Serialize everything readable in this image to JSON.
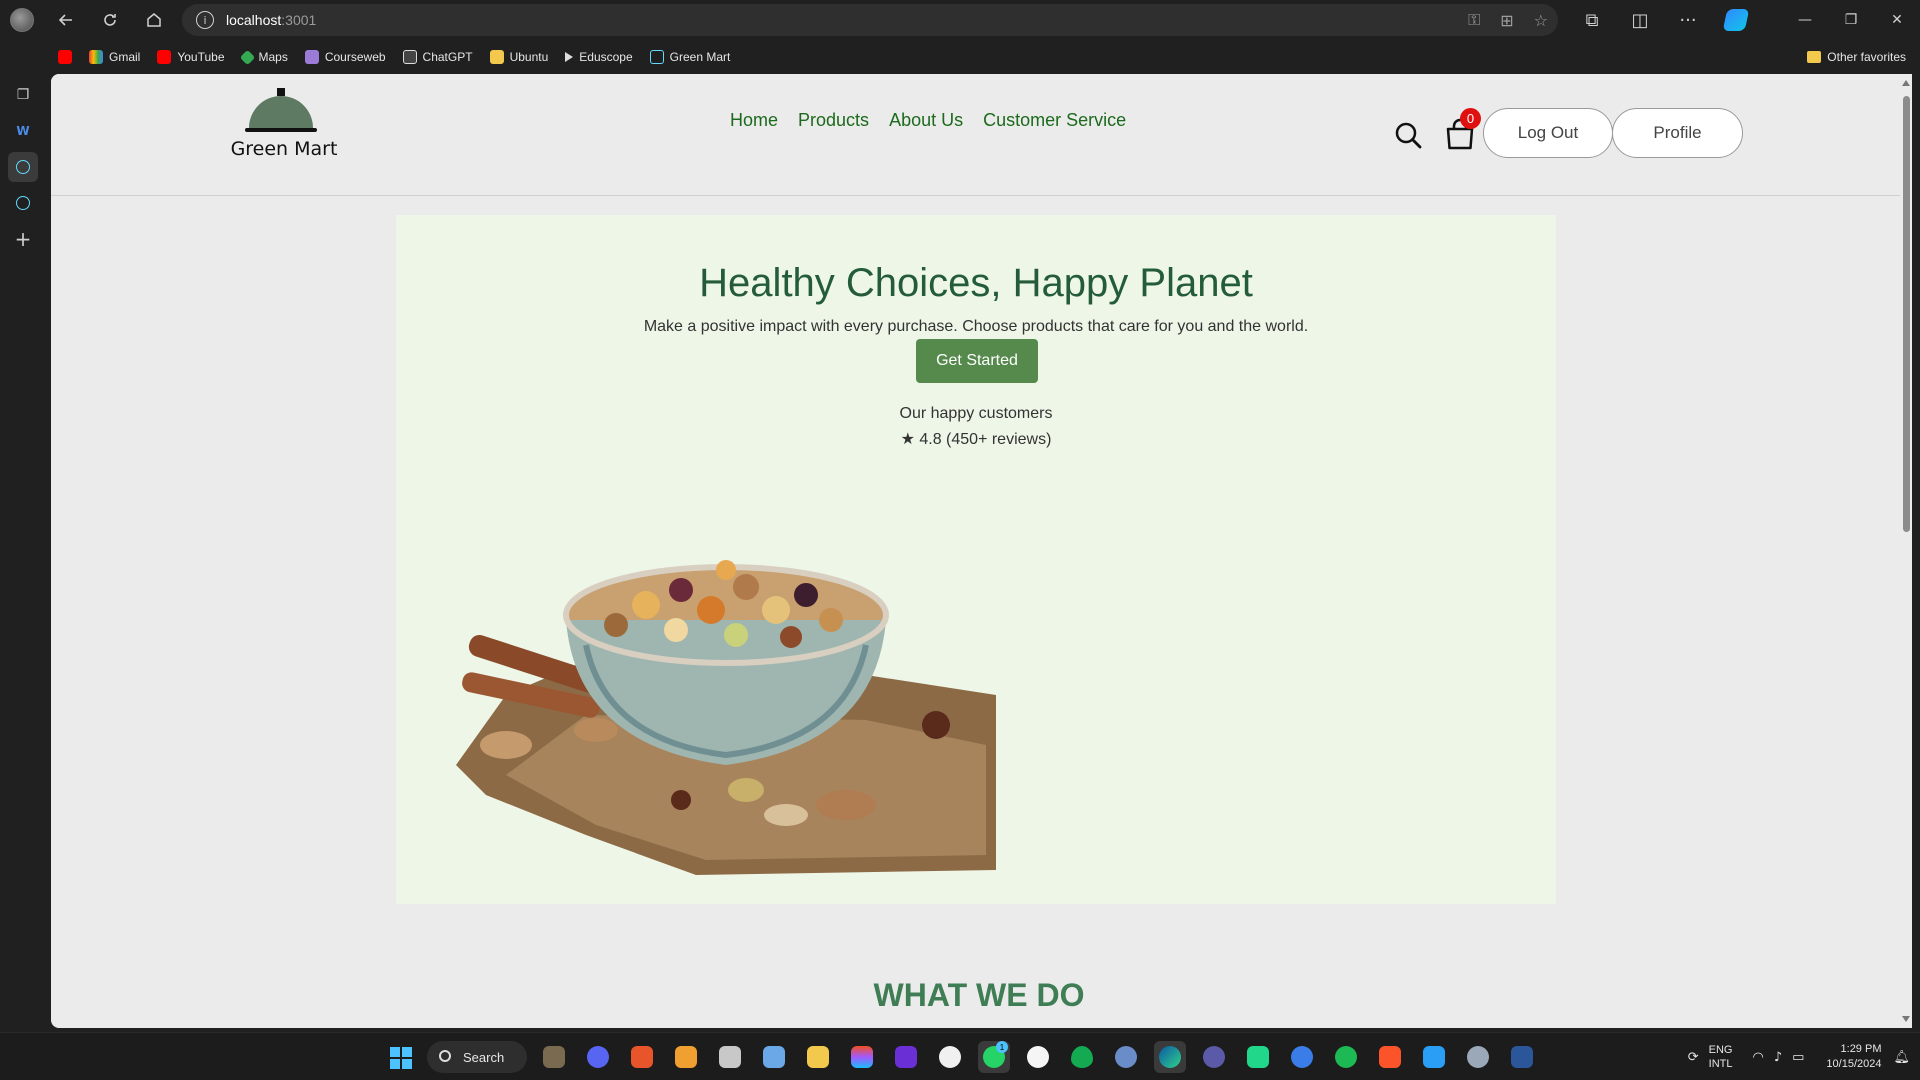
{
  "browser": {
    "url_host": "localhost",
    "url_port": ":3001",
    "bookmarks": [
      {
        "label": "",
        "icon": "youtube-icon"
      },
      {
        "label": "Gmail",
        "icon": "gmail-icon"
      },
      {
        "label": "YouTube",
        "icon": "youtube-icon"
      },
      {
        "label": "Maps",
        "icon": "maps-icon"
      },
      {
        "label": "Courseweb",
        "icon": "courseweb-icon"
      },
      {
        "label": "ChatGPT",
        "icon": "chatgpt-icon"
      },
      {
        "label": "Ubuntu",
        "icon": "folder-icon"
      },
      {
        "label": "Eduscope",
        "icon": "play-icon"
      },
      {
        "label": "Green Mart",
        "icon": "react-icon"
      }
    ],
    "other_favorites": "Other favorites"
  },
  "site": {
    "brand": "Green Mart",
    "nav": [
      "Home",
      "Products",
      "About Us",
      "Customer Service"
    ],
    "cart_count": "0",
    "logout_label": "Log Out",
    "profile_label": "Profile"
  },
  "hero": {
    "title": "Healthy Choices, Happy Planet",
    "subtitle": "Make a positive impact with every purchase. Choose products that care for you and the world.",
    "cta": "Get Started",
    "customers_label": "Our happy customers",
    "rating": "★ 4.8 (450+ reviews)"
  },
  "section": {
    "title": "WHAT WE DO"
  },
  "taskbar": {
    "search_label": "Search",
    "lang_line1": "ENG",
    "lang_line2": "INTL",
    "time": "1:29 PM",
    "date": "10/15/2024",
    "whatsapp_badge": "1"
  },
  "colors": {
    "brand_green": "#1c6a1c",
    "hero_title": "#245c3a",
    "cta_bg": "#558a4c",
    "hero_bg": "#eef6e8",
    "badge_red": "#e01010"
  }
}
